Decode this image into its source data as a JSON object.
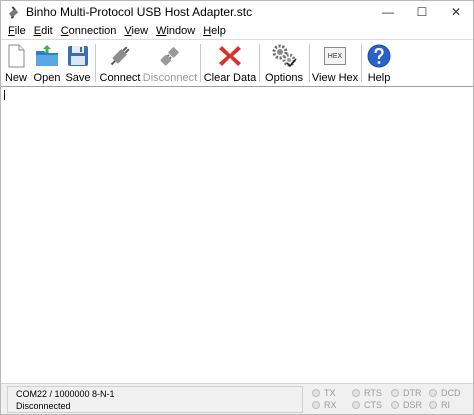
{
  "window": {
    "title": "Binho Multi-Protocol USB Host Adapter.stc",
    "controls": {
      "minimize": "—",
      "maximize": "☐",
      "close": "✕"
    }
  },
  "menu": [
    {
      "underline": "F",
      "rest": "ile"
    },
    {
      "underline": "E",
      "rest": "dit"
    },
    {
      "underline": "C",
      "rest": "onnection"
    },
    {
      "underline": "V",
      "rest": "iew"
    },
    {
      "underline": "W",
      "rest": "indow"
    },
    {
      "underline": "H",
      "rest": "elp"
    }
  ],
  "toolbar": {
    "new": "New",
    "open": "Open",
    "save": "Save",
    "connect": "Connect",
    "disconnect": "Disconnect",
    "clear_data": "Clear Data",
    "options": "Options",
    "view_hex": "View Hex",
    "hex_badge": "HEX",
    "help": "Help"
  },
  "status": {
    "port": "COM22 / 1000000 8-N-1",
    "state": "Disconnected"
  },
  "leds": [
    {
      "label": "TX",
      "on": false
    },
    {
      "label": "RX",
      "on": false
    },
    {
      "label": "RTS",
      "on": false
    },
    {
      "label": "CTS",
      "on": false
    },
    {
      "label": "DTR",
      "on": false
    },
    {
      "label": "DSR",
      "on": false
    },
    {
      "label": "DCD",
      "on": false
    },
    {
      "label": "RI",
      "on": false
    }
  ],
  "colors": {
    "folder": "#3a8fd6",
    "save_disk": "#3b6fb5",
    "clear_x": "#d9342b",
    "help": "#2a63c7"
  }
}
